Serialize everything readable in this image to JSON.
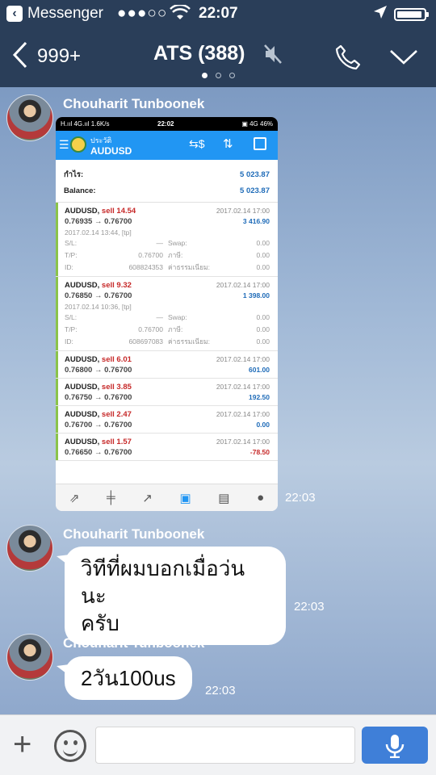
{
  "status_bar": {
    "carrier": "Messenger",
    "signal": "●●●○○",
    "time": "22:07"
  },
  "header": {
    "back_count": "999+",
    "title": "ATS (388)"
  },
  "messages": [
    {
      "sender": "Chouharit Tunboonek",
      "type": "image",
      "time": "22:03"
    },
    {
      "sender": "Chouharit Tunboonek",
      "type": "text",
      "text_line1": "วิทีที่ผมบอกเมื่อว่นนะ",
      "text_line2": "ครับ",
      "time": "22:03"
    },
    {
      "sender": "Chouharit Tunboonek",
      "type": "text",
      "text_line1": "2วัน100us",
      "time": "22:03"
    }
  ],
  "screenshot": {
    "status": {
      "left": "H.ııl 4G.ııl 1.6K/s",
      "time": "22:02",
      "right": "▣ 4G 46%"
    },
    "app_title_top": "ประวัติ",
    "app_title": "AUDUSD",
    "summary": [
      {
        "label": "กำไร:",
        "value": "5 023.87"
      },
      {
        "label": "Balance:",
        "value": "5 023.87"
      }
    ],
    "trades": [
      {
        "sym": "AUDUSD,",
        "side": "sell 14.54",
        "date": "2017.02.14 17:00",
        "prices": "0.76935 → 0.76700",
        "pl": "3 416.90",
        "open": "2017.02.14 13:44, [tp]",
        "sl_label": "S/L:",
        "sl": "—",
        "swap_label": "Swap:",
        "swap": "0.00",
        "tp_label": "T/P:",
        "tp": "0.76700",
        "tax_label": "ภาษี:",
        "tax": "0.00",
        "id_label": "ID:",
        "id": "608824353",
        "fee_label": "ค่าธรรมเนียม:",
        "fee": "0.00"
      },
      {
        "sym": "AUDUSD,",
        "side": "sell 9.32",
        "date": "2017.02.14 17:00",
        "prices": "0.76850 → 0.76700",
        "pl": "1 398.00",
        "open": "2017.02.14 10:36, [tp]",
        "sl_label": "S/L:",
        "sl": "—",
        "swap_label": "Swap:",
        "swap": "0.00",
        "tp_label": "T/P:",
        "tp": "0.76700",
        "tax_label": "ภาษี:",
        "tax": "0.00",
        "id_label": "ID:",
        "id": "608697083",
        "fee_label": "ค่าธรรมเนียม:",
        "fee": "0.00"
      },
      {
        "sym": "AUDUSD,",
        "side": "sell 6.01",
        "date": "2017.02.14 17:00",
        "prices": "0.76800 → 0.76700",
        "pl": "601.00"
      },
      {
        "sym": "AUDUSD,",
        "side": "sell 3.85",
        "date": "2017.02.14 17:00",
        "prices": "0.76750 → 0.76700",
        "pl": "192.50"
      },
      {
        "sym": "AUDUSD,",
        "side": "sell 2.47",
        "date": "2017.02.14 17:00",
        "prices": "0.76700 → 0.76700",
        "pl": "0.00"
      },
      {
        "sym": "AUDUSD,",
        "side": "sell 1.57",
        "date": "2017.02.14 17:00",
        "prices": "0.76650 → 0.76700",
        "pl": "-78.50"
      }
    ]
  },
  "colors": {
    "header_bg": "#2a3e59",
    "app_blue": "#2196f3",
    "sell_red": "#c62828",
    "profit_blue": "#1e6bb8",
    "mic_blue": "#3f7fd8"
  }
}
